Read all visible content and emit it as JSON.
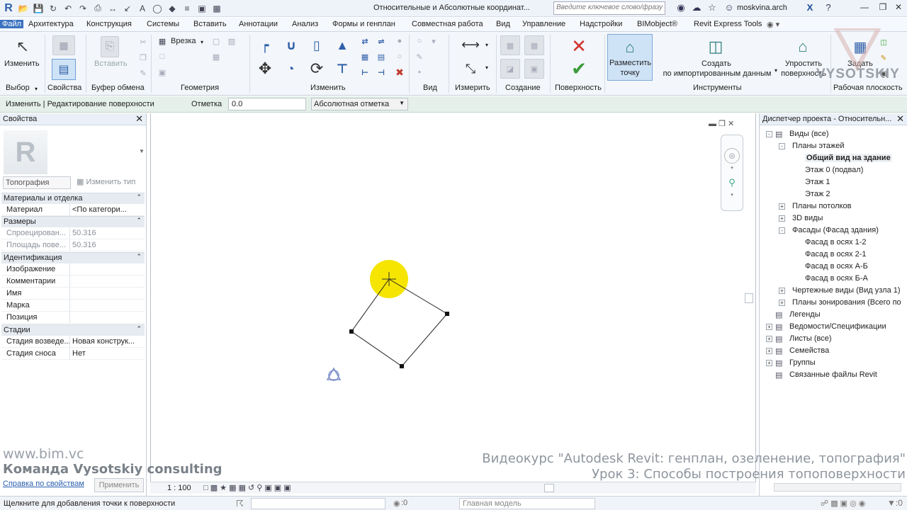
{
  "titlebar": {
    "document_title": "Относительные и Абсолютные координат...",
    "search_placeholder": "Введите ключевое слово/фразу",
    "user": "moskvina.arch"
  },
  "ribbon_tabs": [
    "Файл",
    "Архитектура",
    "Конструкция",
    "Системы",
    "Вставить",
    "Аннотации",
    "Анализ",
    "Формы и генплан",
    "Совместная работа",
    "Вид",
    "Управление",
    "Надстройки",
    "BIMobject®",
    "Revit Express Tools"
  ],
  "ribbon": {
    "modify_label": "Изменить",
    "select_panel": "Выбор",
    "properties_panel": "Свойства",
    "paste_label": "Вставить",
    "clipboard_panel": "Буфер обмена",
    "cut_label": "Врезка",
    "geometry_panel": "Геометрия",
    "modify_panel": "Изменить",
    "view_panel": "Вид",
    "measure_panel": "Измерить",
    "create_panel": "Создание",
    "surface_panel": "Поверхность",
    "place_point_line1": "Разместить",
    "place_point_line2": "точку",
    "create_from_import_line1": "Создать",
    "create_from_import_line2": "по импортированным данным",
    "simplify_line1": "Упростить",
    "simplify_line2": "поверхность",
    "tools_panel": "Инструменты",
    "set_label": "Задать",
    "workplane_panel": "Рабочая плоскость"
  },
  "options_bar": {
    "context": "Изменить | Редактирование поверхности",
    "elevation_label": "Отметка",
    "elevation_value": "0.0",
    "mode": "Абсолютная отметка"
  },
  "properties": {
    "title": "Свойства",
    "family": "Топография",
    "edit_type": "Изменить тип",
    "groups": [
      {
        "name": "Материалы и отделка",
        "rows": [
          {
            "k": "Материал",
            "v": "<По категори..."
          }
        ]
      },
      {
        "name": "Размеры",
        "rows": [
          {
            "k": "Спроецирован...",
            "v": "50.316"
          },
          {
            "k": "Площадь пове...",
            "v": "50.316"
          }
        ]
      },
      {
        "name": "Идентификация",
        "rows": [
          {
            "k": "Изображение",
            "v": ""
          },
          {
            "k": "Комментарии",
            "v": ""
          },
          {
            "k": "Имя",
            "v": ""
          },
          {
            "k": "Марка",
            "v": ""
          },
          {
            "k": "Позиция",
            "v": ""
          }
        ]
      },
      {
        "name": "Стадии",
        "rows": [
          {
            "k": "Стадия возведе...",
            "v": "Новая конструк..."
          },
          {
            "k": "Стадия сноса",
            "v": "Нет"
          }
        ]
      }
    ],
    "help_link": "Справка по свойствам",
    "apply": "Применить"
  },
  "view": {
    "scale": "1 : 100"
  },
  "browser": {
    "title": "Диспетчер проекта - Относительн...",
    "nodes": [
      {
        "label": "Виды (все)",
        "level": 0,
        "exp": "-"
      },
      {
        "label": "Планы этажей",
        "level": 1,
        "exp": "-"
      },
      {
        "label": "Общий вид на здание",
        "level": 2,
        "bold": true
      },
      {
        "label": "Этаж 0 (подвал)",
        "level": 2
      },
      {
        "label": "Этаж 1",
        "level": 2
      },
      {
        "label": "Этаж 2",
        "level": 2
      },
      {
        "label": "Планы потолков",
        "level": 1,
        "exp": "+"
      },
      {
        "label": "3D виды",
        "level": 1,
        "exp": "+"
      },
      {
        "label": "Фасады (Фасад здания)",
        "level": 1,
        "exp": "-"
      },
      {
        "label": "Фасад в осях 1-2",
        "level": 2
      },
      {
        "label": "Фасад в осях 2-1",
        "level": 2
      },
      {
        "label": "Фасад в осях А-Б",
        "level": 2
      },
      {
        "label": "Фасад в осях Б-А",
        "level": 2
      },
      {
        "label": "Чертежные виды (Вид узла 1)",
        "level": 1,
        "exp": "+"
      },
      {
        "label": "Планы зонирования (Всего по",
        "level": 1,
        "exp": "+"
      },
      {
        "label": "Легенды",
        "level": 0,
        "exp": ""
      },
      {
        "label": "Ведомости/Спецификации",
        "level": 0,
        "exp": "+"
      },
      {
        "label": "Листы (все)",
        "level": 0,
        "exp": "+"
      },
      {
        "label": "Семейства",
        "level": 0,
        "exp": "+"
      },
      {
        "label": "Группы",
        "level": 0,
        "exp": "+"
      },
      {
        "label": "Связанные файлы Revit",
        "level": 0,
        "exp": ""
      }
    ]
  },
  "status": {
    "text": "Щелкните для добавления точки к поверхности",
    "filter_count": ":0",
    "model": "Главная модель"
  },
  "watermark": {
    "url": "www.bim.vc",
    "team": "Команда Vysotskiy consulting",
    "course": "Видеокурс \"Autodesk Revit: генплан, озеленение, топография\"",
    "lesson": "Урок 3: Способы построения топоповерхности",
    "logo": "VYSOTSKIY"
  }
}
